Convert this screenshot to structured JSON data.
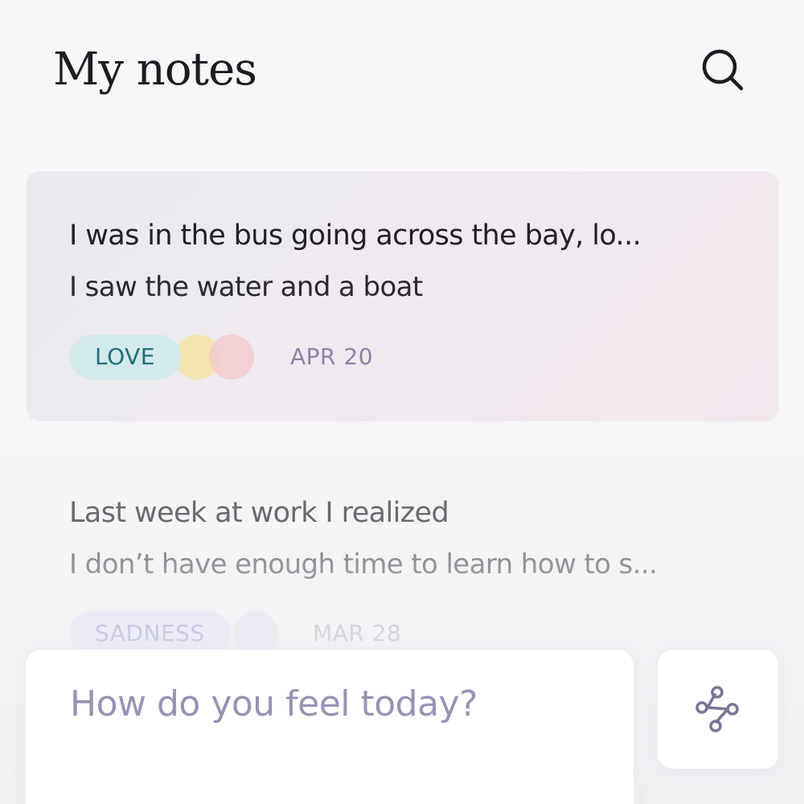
{
  "header": {
    "title": "My notes",
    "search_icon": "search-icon"
  },
  "notes": [
    {
      "title": "I was in the bus going across the bay, lo...",
      "body": "I saw the water and a boat",
      "tag": "LOVE",
      "tag_colors": {
        "background": "#d3e9ec",
        "text": "#1f6f79"
      },
      "extra_emotion_dots": [
        "#f4e2a0",
        "#f3c9cd"
      ],
      "date": "APR 20",
      "highlighted": true
    },
    {
      "title": "Last week at work I realized",
      "body": "I don’t have enough time to learn how to s...",
      "tag": "SADNESS",
      "tag_colors": {
        "background": "#d8dcf7",
        "text": "#5864b4"
      },
      "extra_emotion_dots": [
        "#d6d2f2"
      ],
      "date": "MAR 28",
      "highlighted": false
    }
  ],
  "composer": {
    "placeholder": "How do you feel today?",
    "graph_icon": "connections-graph-icon"
  },
  "colors": {
    "background": "#f7f5f7",
    "title_text": "#1d1b20",
    "date_text": "#8b84a6",
    "placeholder_text": "#9793b3"
  }
}
